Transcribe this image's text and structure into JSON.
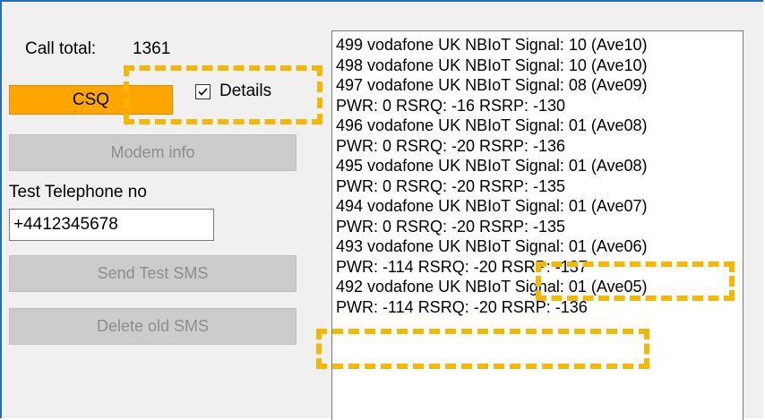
{
  "call_total": {
    "label": "Call total:",
    "value": "1361"
  },
  "buttons": {
    "csq": "CSQ",
    "modem_info": "Modem info",
    "send_test_sms": "Send Test SMS",
    "delete_old_sms": "Delete old SMS"
  },
  "details_checkbox": {
    "label": "Details",
    "checked": true
  },
  "test_phone": {
    "label": "Test Telephone no",
    "value": "+4412345678"
  },
  "log_lines": [
    "499 vodafone UK NBIoT Signal: 10 (Ave10)",
    "498 vodafone UK NBIoT Signal: 10 (Ave10)",
    "497 vodafone UK NBIoT Signal: 08 (Ave09)",
    "PWR: 0 RSRQ: -16 RSRP: -130",
    "496 vodafone UK NBIoT Signal: 01 (Ave08)",
    "PWR: 0 RSRQ: -20 RSRP: -136",
    "495 vodafone UK NBIoT Signal: 01 (Ave08)",
    "PWR: 0 RSRQ: -20 RSRP: -135",
    "494 vodafone UK NBIoT Signal: 01 (Ave07)",
    "PWR: 0 RSRQ: -20 RSRP: -135",
    "493 vodafone UK NBIoT Signal: 01 (Ave06)",
    "PWR: -114 RSRQ: -20 RSRP: -137",
    "492 vodafone UK NBIoT Signal: 01 (Ave05)",
    "PWR: -114 RSRQ: -20 RSRP: -136"
  ],
  "colors": {
    "csq_button": "#ffa500",
    "highlight": "#f5b800",
    "frame_border": "#2b6cb0"
  }
}
